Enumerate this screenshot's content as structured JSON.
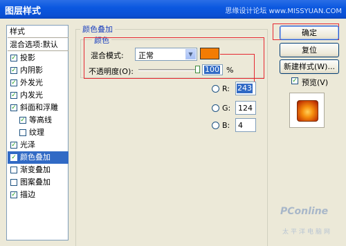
{
  "window": {
    "title": "图层样式",
    "watermark": "思缘设计论坛 www.MISSYUAN.COM"
  },
  "left_panel": {
    "header": "样式",
    "blend_options": "混合选项:默认",
    "items": [
      {
        "label": "投影",
        "checked": true
      },
      {
        "label": "内阴影",
        "checked": true
      },
      {
        "label": "外发光",
        "checked": true
      },
      {
        "label": "内发光",
        "checked": true
      },
      {
        "label": "斜面和浮雕",
        "checked": true
      },
      {
        "label": "等高线",
        "checked": true
      },
      {
        "label": "纹理",
        "checked": false
      },
      {
        "label": "光泽",
        "checked": true
      },
      {
        "label": "颜色叠加",
        "checked": true
      },
      {
        "label": "渐变叠加",
        "checked": false
      },
      {
        "label": "图案叠加",
        "checked": false
      },
      {
        "label": "描边",
        "checked": true
      }
    ],
    "check_mark": "✓"
  },
  "color_overlay": {
    "group_title": "颜色叠加",
    "subgroup_title": "颜色",
    "blend_mode_label": "混合模式:",
    "blend_mode_value": "正常",
    "swatch_color": "#f37c04",
    "opacity_label": "不透明度(O):",
    "opacity_value": "100",
    "opacity_unit": "%",
    "opacity_fraction": 1.0
  },
  "color_picker": {
    "r_label": "R:",
    "r_value": "243",
    "g_label": "G:",
    "g_value": "124",
    "b_label": "B:",
    "b_value": "4"
  },
  "buttons": {
    "ok": "确定",
    "reset": "复位",
    "new_style": "新建样式(W)...",
    "preview": "预览(V)"
  },
  "accent_color": "#e6262f",
  "logo": {
    "main": "PConline",
    "sub": "太平洋电脑网"
  }
}
